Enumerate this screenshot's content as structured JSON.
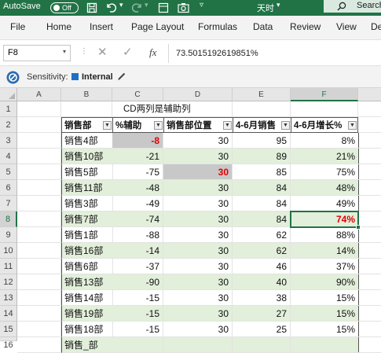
{
  "titlebar": {
    "autosave_label": "AutoSave",
    "autosave_state": "Off",
    "doc_name": "天时",
    "search_label": "Search"
  },
  "menu": [
    "File",
    "Home",
    "Insert",
    "Page Layout",
    "Formulas",
    "Data",
    "Review",
    "View",
    "De"
  ],
  "formula_bar": {
    "name_box": "F8",
    "fx": "fx",
    "value": "73.5015192619851%"
  },
  "sensitivity": {
    "label": "Sensitivity:",
    "value": "Internal"
  },
  "columns": [
    "A",
    "B",
    "C",
    "D",
    "E",
    "F"
  ],
  "rows": [
    "1",
    "2",
    "3",
    "4",
    "5",
    "6",
    "7",
    "8",
    "9",
    "10",
    "11",
    "12",
    "13",
    "14",
    "15",
    "16"
  ],
  "note_cell": "CD两列是辅助列",
  "table_headers": [
    "销售部",
    "%辅助",
    "销售部位置",
    "4-6月销售",
    "4-6月增长%"
  ],
  "table_rows": [
    [
      "销售4部",
      "-8",
      "30",
      "95",
      "8%"
    ],
    [
      "销售10部",
      "-21",
      "30",
      "89",
      "21%"
    ],
    [
      "销售5部",
      "-75",
      "30",
      "85",
      "75%"
    ],
    [
      "销售11部",
      "-48",
      "30",
      "84",
      "48%"
    ],
    [
      "销售3部",
      "-49",
      "30",
      "84",
      "49%"
    ],
    [
      "销售7部",
      "-74",
      "30",
      "84",
      "74%"
    ],
    [
      "销售1部",
      "-88",
      "30",
      "62",
      "88%"
    ],
    [
      "销售16部",
      "-14",
      "30",
      "62",
      "14%"
    ],
    [
      "销售6部",
      "-37",
      "30",
      "46",
      "37%"
    ],
    [
      "销售13部",
      "-90",
      "30",
      "40",
      "90%"
    ],
    [
      "销售14部",
      "-15",
      "30",
      "38",
      "15%"
    ],
    [
      "销售19部",
      "-15",
      "30",
      "27",
      "15%"
    ],
    [
      "销售18部",
      "-15",
      "30",
      "25",
      "15%"
    ],
    [
      "销售_部",
      "",
      "",
      "",
      ""
    ]
  ],
  "colors": {
    "excel_green": "#217346",
    "band": "#e2efda",
    "highlight_red": "#e00000",
    "selected_grey": "#c8c8c8"
  }
}
